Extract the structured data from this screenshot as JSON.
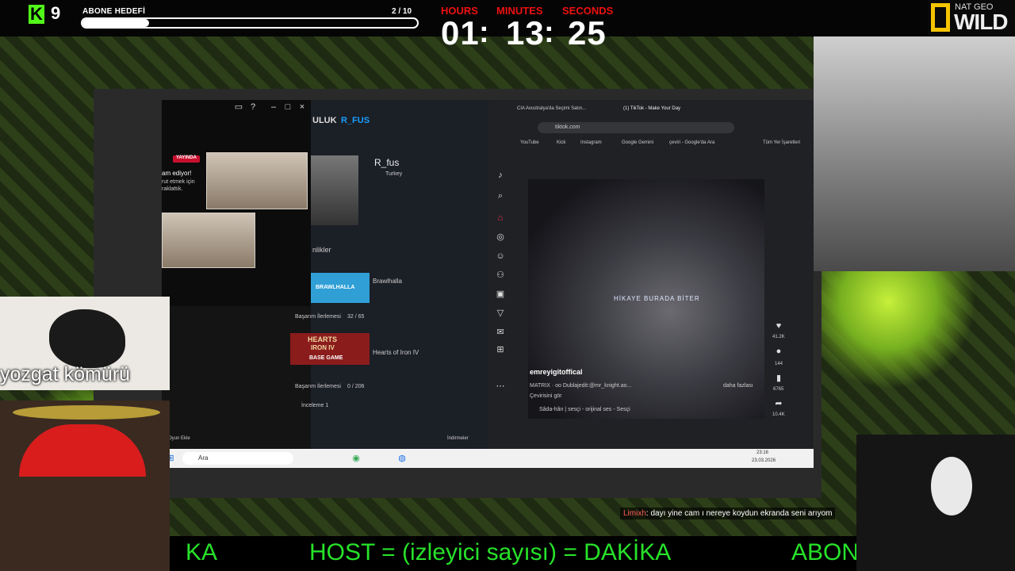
{
  "kick": {
    "icon": "kick-logo-icon",
    "count": "9",
    "accent": "#53fc18"
  },
  "subgoal": {
    "label": "ABONE HEDEFİ",
    "count": "2 / 10",
    "progress": 0.2
  },
  "timer": {
    "hours_label": "HOURS",
    "minutes_label": "MINUTES",
    "seconds_label": "SECONDS",
    "hours": "01",
    "minutes": "13",
    "seconds": "25",
    "sep": ":",
    "label_color": "#e11111"
  },
  "natgeo": {
    "line1": "NAT GEO",
    "line2": "WILD"
  },
  "screen": {
    "live_badge": "YAYINDA",
    "live_text1": "am ediyor!",
    "live_text2": "rut etmek için",
    "live_text3": "raklattık.",
    "steam": {
      "tab_a": "ULUK",
      "tab_b": "R_FUS",
      "username": "R_fus",
      "country": "Turkey",
      "section": "nlikler",
      "game1": "Brawlhalla",
      "game1_logo": "BRAWLHALLA",
      "progress_label": "Başarım İlerlemesi",
      "progress1": "32 / 65",
      "game2": "Hearts of Iron IV",
      "game2_logo_a": "HEARTS",
      "game2_logo_b": "IRON IV",
      "game2_logo_c": "BASE GAME",
      "progress2": "0 / 206",
      "review": "İnceleme 1",
      "footer_left": "Oyun Ekle",
      "footer_right": "İndirmeler"
    },
    "browser": {
      "tab1": "CIA Avustralya'da Seçimi Satın...",
      "tab2": "(1) TikTok - Make Your Day",
      "url": "tiktok.com",
      "bookmarks": [
        "YouTube",
        "Kick",
        "Instagram",
        "Google Gemini",
        "çeviri - Google'da Ara"
      ],
      "all_bookmarks": "Tüm Yer İşaretleri",
      "video_overlay": "HİKAYE BURADA BİTER",
      "author": "emreyigitoffical",
      "caption": "MATRIX · oo Dublajedit:@mr_knight.ao...",
      "translate": "Çevirisini gör",
      "more": "daha fazlası",
      "sound": "Sâda-hân | sesçi - orijinal ses - Sesçi",
      "likes": "41.2K",
      "comments": "144",
      "saves": "6765",
      "shares": "10.4K"
    },
    "taskbar": {
      "search": "Ara",
      "time": "23:16",
      "date": "23.03.2026"
    }
  },
  "coal_label": "yozgat kömürü",
  "chat": {
    "user": "Limixh",
    "sep": ":",
    "message": "dayı yine cam ı nereye koydun ekranda seni arıyom"
  },
  "ticker": {
    "part1": "KA",
    "part2": "HOST = (izleyici sayısı) = DAKİKA",
    "part3": "ABON"
  }
}
